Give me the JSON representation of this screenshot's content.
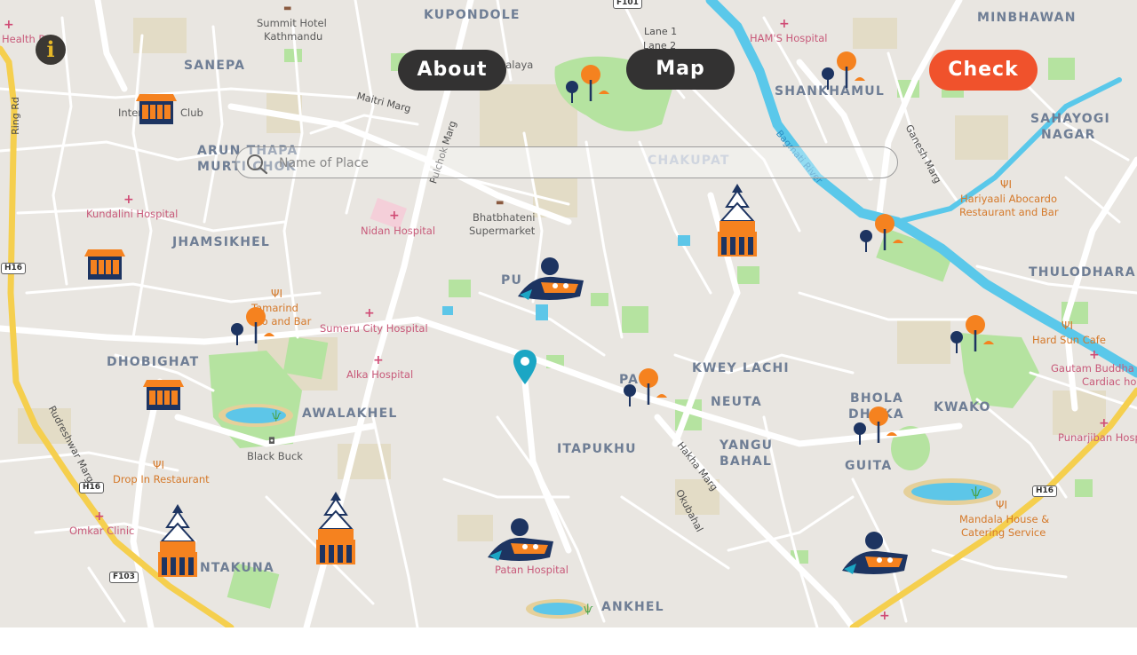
{
  "nav": {
    "about_label": "About",
    "map_label": "Map",
    "check_label": "Check",
    "info_label": "i"
  },
  "search": {
    "placeholder": "Name of Place",
    "value": ""
  },
  "colors": {
    "button_dark": "#333232",
    "button_accent": "#f0522c",
    "info_glyph": "#e7b828",
    "marker": "#1ba6c4",
    "river": "#5ac8ea",
    "major_road": "#f5cf4e",
    "park": "#b5e3a0"
  },
  "map": {
    "areas": {
      "kupondole": "KUPONDOLE",
      "minbhawan": "MINBHAWAN",
      "sanepa": "SANEPA",
      "shankhamul": "SHANKHAMUL",
      "sahayogi_1": "SAHAYOGI",
      "sahayogi_2": "NAGAR",
      "arun_thapa_1": "ARUN THAPA",
      "arun_thapa_2": "MURTI CHOK",
      "chakupat": "CHAKUPAT",
      "jhamsikhel": "JHAMSIKHEL",
      "thulodhara": "THULODHARA",
      "pulchowk": "PU",
      "dhobighat": "DHOBIGHAT",
      "kwey_lachi": "KWEY LACHI",
      "patan": "PA   N",
      "neuta": "NEUTA",
      "bhola_1": "BHOLA",
      "bhola_2": "DHOKA",
      "kwako": "KWAKO",
      "jawalakhel": "AWALAKHEL",
      "itapukhu": "ITAPUKHU",
      "yangu_1": "YANGU",
      "yangu_2": "BAHAL",
      "guita": "GUITA",
      "ntakuna": "NTAKUNA",
      "ankhel": "ANKHEL"
    },
    "places": {
      "health": "Health P",
      "summit_1": "Summit Hotel",
      "summit_2": "Kathmandu",
      "malaya": "malaya",
      "hams": "HAM'S Hospital",
      "inter": "Inter",
      "club": "Club",
      "kundalini": "Kundalini Hospital",
      "nidan": "Nidan Hospital",
      "bhatbhateni_1": "Bhatbhateni",
      "bhatbhateni_2": "Supermarket",
      "hariyaali_1": "Hariyaali Abocardo",
      "hariyaali_2": "Restaurant and Bar",
      "tamarind_1": "Tamarind",
      "tamarind_2": "R    o and Bar",
      "sumeru": "Sumeru City Hospital",
      "hard_sun": "Hard Sun Cafe",
      "alka": "Alka Hospital",
      "gautam_1": "Gautam Buddha In",
      "gautam_2": "Cardiac hos",
      "black_buck": "Black Buck",
      "punarjiban": "Punarjiban Hosp",
      "drop_in": "Drop In Restaurant",
      "omkar": "Omkar Clinic",
      "mandala_1": "Mandala House &",
      "mandala_2": "Catering Service",
      "patan_hospital": "Patan Hospital"
    },
    "roads": {
      "lane1": "Lane 1",
      "lane2": "Lane 2",
      "maitri": "Maitri Marg",
      "pulchok": "Pulchok Marg",
      "ring": "Ring Rd",
      "ganesh": "Ganesh Marg",
      "rudreshwar": "Rudreshwar Marg",
      "hakha": "Hakha Marg",
      "okubahal": "Okubahal",
      "bagmati": "Bagmati River"
    },
    "shields": {
      "f101": "F101",
      "h16_a": "H16",
      "h16_b": "H16",
      "h16_c": "H16",
      "f103": "F103"
    }
  }
}
